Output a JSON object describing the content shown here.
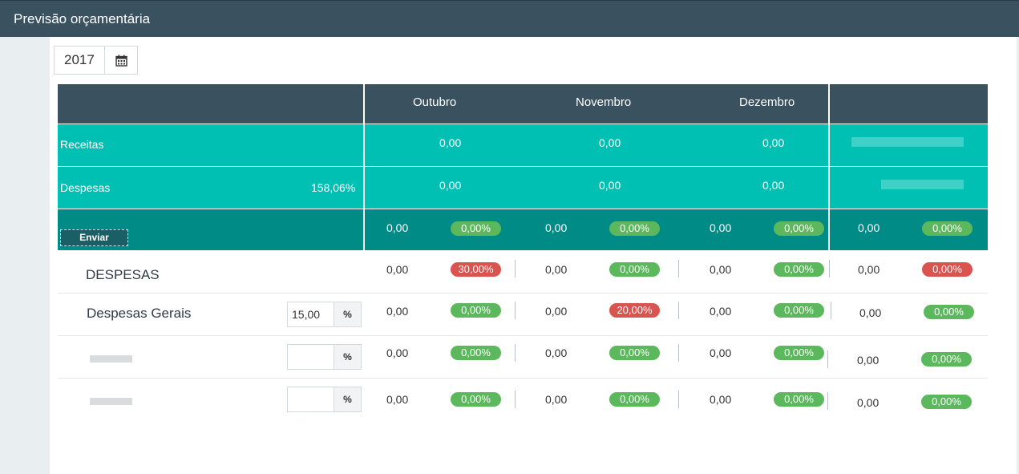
{
  "window": {
    "title": "Previsão orçamentária"
  },
  "year_picker": {
    "value": "2017",
    "icon": "calendar-icon"
  },
  "header": {
    "months": [
      "Outubro",
      "Novembro",
      "Dezembro"
    ]
  },
  "summary": {
    "receitas": {
      "label": "Receitas",
      "values": [
        "0,00",
        "0,00",
        "0,00"
      ]
    },
    "despesas": {
      "label": "Despesas",
      "percent": "158,06%",
      "values": [
        "0,00",
        "0,00",
        "0,00"
      ]
    },
    "totals": {
      "send_button": "Enviar",
      "cells": [
        {
          "value": "0,00",
          "pct": "0,00%",
          "status": "green"
        },
        {
          "value": "0,00",
          "pct": "0,00%",
          "status": "green"
        },
        {
          "value": "0,00",
          "pct": "0,00%",
          "status": "green"
        },
        {
          "value": "0,00",
          "pct": "0,00%",
          "status": "green"
        }
      ]
    }
  },
  "rows": [
    {
      "label": "DESPESAS",
      "input": null,
      "cells": [
        {
          "value": "0,00",
          "pct": "30,00%",
          "status": "red"
        },
        {
          "value": "0,00",
          "pct": "0,00%",
          "status": "green"
        },
        {
          "value": "0,00",
          "pct": "0,00%",
          "status": "green"
        },
        {
          "value": "0,00",
          "pct": "0,00%",
          "status": "red"
        }
      ]
    },
    {
      "label": "Despesas Gerais",
      "input": {
        "value": "15,00",
        "unit": "%"
      },
      "cells": [
        {
          "value": "0,00",
          "pct": "0,00%",
          "status": "green"
        },
        {
          "value": "0,00",
          "pct": "20,00%",
          "status": "red"
        },
        {
          "value": "0,00",
          "pct": "0,00%",
          "status": "green"
        },
        {
          "value": "0,00",
          "pct": "0,00%",
          "status": "green"
        }
      ]
    },
    {
      "label": "",
      "input": {
        "value": "",
        "unit": "%"
      },
      "cells": [
        {
          "value": "0,00",
          "pct": "0,00%",
          "status": "green"
        },
        {
          "value": "0,00",
          "pct": "0,00%",
          "status": "green"
        },
        {
          "value": "0,00",
          "pct": "0,00%",
          "status": "green"
        },
        {
          "value": "0,00",
          "pct": "0,00%",
          "status": "green"
        }
      ]
    },
    {
      "label": "",
      "input": {
        "value": "",
        "unit": "%"
      },
      "cells": [
        {
          "value": "0,00",
          "pct": "0,00%",
          "status": "green"
        },
        {
          "value": "0,00",
          "pct": "0,00%",
          "status": "green"
        },
        {
          "value": "0,00",
          "pct": "0,00%",
          "status": "green"
        },
        {
          "value": "0,00",
          "pct": "0,00%",
          "status": "green"
        }
      ]
    }
  ],
  "colors": {
    "header_dark": "#3a5260",
    "teal": "#00bfb3",
    "teal_dark": "#008b87",
    "status_green": "#5cb85c",
    "status_red": "#d9534f"
  }
}
